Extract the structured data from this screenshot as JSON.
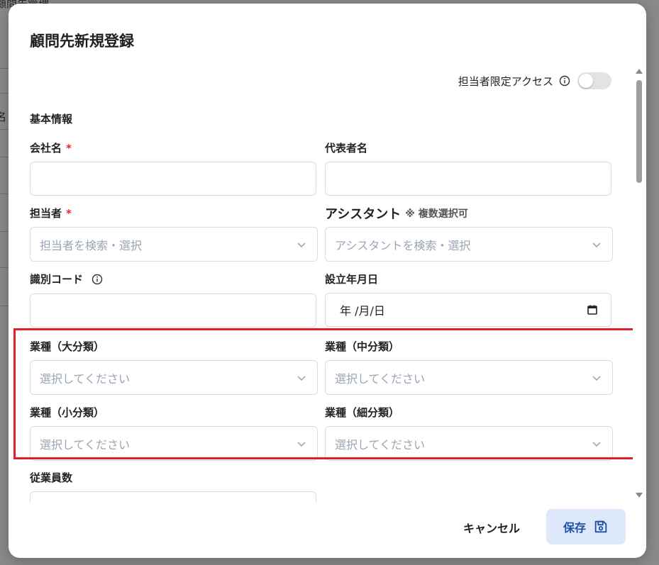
{
  "background": {
    "page_title": "顧問先管理",
    "side_text": "名"
  },
  "modal": {
    "title": "顧問先新規登録",
    "access_label": "担当者限定アクセス",
    "section_basic": "基本情報",
    "fields": {
      "company_name": {
        "label": "会社名",
        "required": "*"
      },
      "representative": {
        "label": "代表者名"
      },
      "assignee": {
        "label": "担当者",
        "required": "*",
        "placeholder": "担当者を検索・選択"
      },
      "assistant": {
        "label": "アシスタント",
        "note": "※ 複数選択可",
        "placeholder": "アシスタントを検索・選択"
      },
      "code": {
        "label": "識別コード"
      },
      "founded": {
        "label": "設立年月日",
        "placeholder": "年 /月/日"
      },
      "industry_large": {
        "label": "業種（大分類）",
        "placeholder": "選択してください"
      },
      "industry_middle": {
        "label": "業種（中分類）",
        "placeholder": "選択してください"
      },
      "industry_small": {
        "label": "業種（小分類）",
        "placeholder": "選択してください"
      },
      "industry_detail": {
        "label": "業種（細分類）",
        "placeholder": "選択してください"
      },
      "employees": {
        "label": "従業員数"
      }
    },
    "cancel_label": "キャンセル",
    "save_label": "保存"
  },
  "colors": {
    "required": "#e02a2a",
    "highlight": "#e0202a",
    "save_bg": "#dde8fb",
    "save_text": "#1f4ea3"
  }
}
